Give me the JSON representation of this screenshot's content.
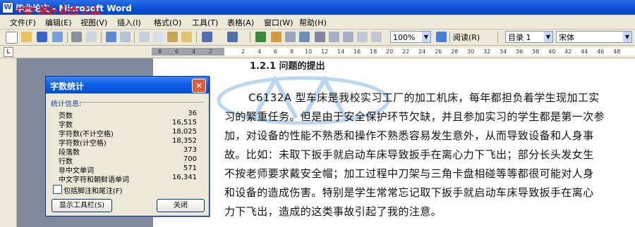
{
  "window": {
    "title": "毕业论文 - Microsoft Word",
    "overlay_caption": "字数统计"
  },
  "menu": [
    "文件(F)",
    "编辑(E)",
    "视图(V)",
    "插入(I)",
    "格式(O)",
    "工具(T)",
    "表格(A)",
    "窗口(W)",
    "帮助(H)"
  ],
  "toolbar": {
    "zoom": "100%",
    "read_label": "阅读(R)",
    "style": "目录 1",
    "font": "宋体"
  },
  "ruler": {
    "ticks": [
      "8",
      "6",
      "4",
      "2",
      "2",
      "4",
      "6",
      "8",
      "10",
      "12",
      "14",
      "16",
      "18",
      "20",
      "22",
      "24",
      "26",
      "28",
      "30",
      "32",
      "34",
      "36",
      "38",
      "40",
      "42",
      "44",
      "46",
      "48"
    ]
  },
  "document": {
    "heading": "1.2.1  问题的提出",
    "lines": [
      "C6132A 型车床是我校实习工厂的加工机床，每年都担负着学生现加工实",
      "习的繁重任务。但是由于安全保护环节欠缺，并且参加实习的学生都是第一次参",
      "加，对设备的性能不熟悉和操作不熟悉容易发生意外，从而导致设备和人身事",
      "故。比如：未取下扳手就启动车床导致扳手在离心力下飞出；部分长头发女生",
      "不按老师要求戴安全帽；加工过程中刀架与三角卡盘相碰等等都很可能对人身",
      "和设备的造成伤害。特别是学生常常忘记取下扳手就启动车床导致扳手在离心",
      "力下飞出，造成的这类事故引起了我的注意。"
    ]
  },
  "dialog": {
    "title": "字数统计",
    "section_label": "统计信息:",
    "stats": [
      {
        "label": "页数",
        "value": "36"
      },
      {
        "label": "字数",
        "value": "16,515"
      },
      {
        "label": "字符数(不计空格)",
        "value": "18,025"
      },
      {
        "label": "字符数(计空格)",
        "value": "18,352"
      },
      {
        "label": "段落数",
        "value": "373"
      },
      {
        "label": "行数",
        "value": "700"
      },
      {
        "label": "非中文单词",
        "value": "571"
      },
      {
        "label": "中文字符和朝鲜语单词",
        "value": "16,341"
      }
    ],
    "checkbox_label": "包括脚注和尾注(F)",
    "toolbar_button": "显示工具栏(S)",
    "close_button": "关闭"
  }
}
